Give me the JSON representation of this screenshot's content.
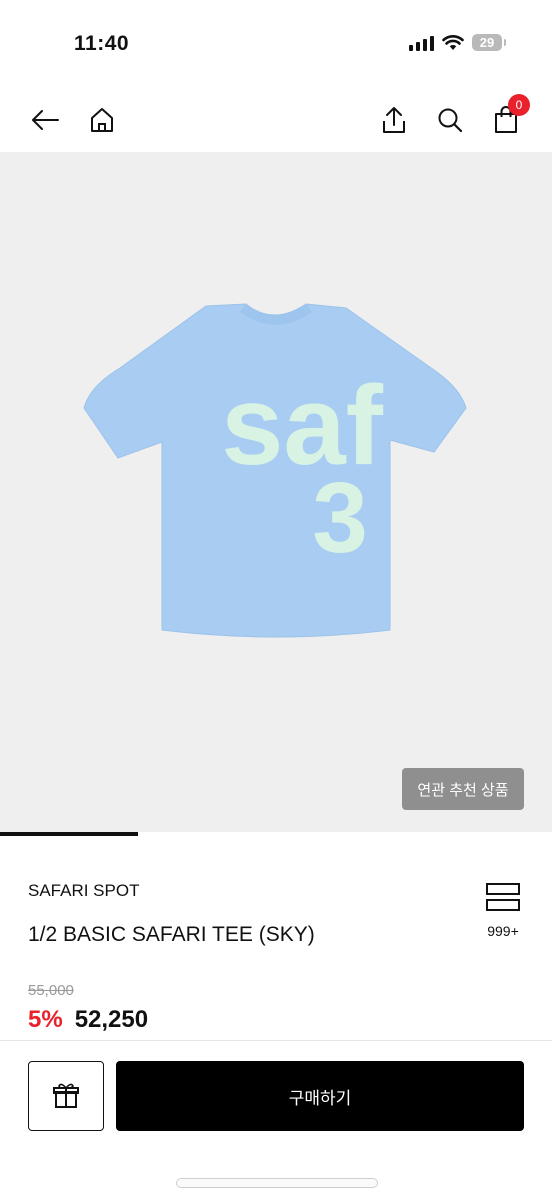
{
  "status": {
    "time": "11:40",
    "battery": "29"
  },
  "nav": {
    "cart_count": "0"
  },
  "hero": {
    "print_line1": "saf",
    "print_line2": "3",
    "recommend_label": "연관 추천 상품",
    "gallery_progress": 0.25
  },
  "product": {
    "brand": "SAFARI SPOT",
    "name": "1/2 BASIC SAFARI TEE (SKY)",
    "review_count": "999+",
    "original_price": "55,000",
    "discount": "5%",
    "price": "52,250"
  },
  "actions": {
    "buy_label": "구매하기"
  },
  "colors": {
    "accent": "#e8212b",
    "tee": "#a9cdf2",
    "print": "#d8f3e4",
    "hero_bg": "#efefef"
  }
}
